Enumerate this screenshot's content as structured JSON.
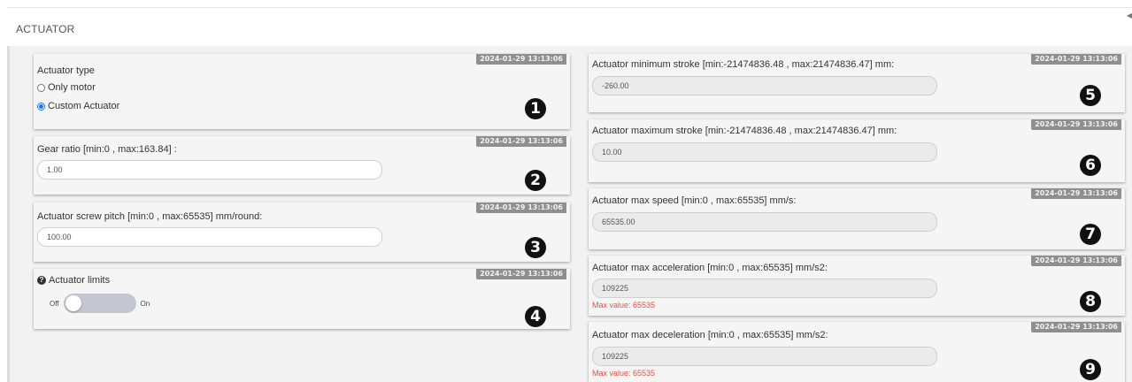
{
  "panel": {
    "title": "ACTUATOR",
    "collapse_icon": "caret-left-icon"
  },
  "left": {
    "actuator_type": {
      "timestamp": "2024-01-29 13:13:06",
      "label": "Actuator type",
      "options": [
        {
          "label": "Only motor",
          "selected": false
        },
        {
          "label": "Custom Actuator",
          "selected": true
        }
      ],
      "badge": "1"
    },
    "gear_ratio": {
      "timestamp": "2024-01-29 13:13:06",
      "label": "Gear ratio [min:0 , max:163.84] :",
      "value": "1.00",
      "badge": "2"
    },
    "screw_pitch": {
      "timestamp": "2024-01-29 13:13:06",
      "label": "Actuator screw pitch [min:0 , max:65535] mm/round:",
      "value": "100.00",
      "badge": "3"
    },
    "limits": {
      "timestamp": "2024-01-29 13:13:06",
      "label": "Actuator limits",
      "icon": "question-circle-icon",
      "off_label": "Off",
      "on_label": "On",
      "enabled": false,
      "badge": "4"
    }
  },
  "right": {
    "min_stroke": {
      "timestamp": "2024-01-29 13:13:06",
      "label": "Actuator minimum stroke [min:-21474836.48 , max:21474836.47] mm:",
      "value": "-260.00",
      "badge": "5"
    },
    "max_stroke": {
      "timestamp": "2024-01-29 13:13:06",
      "label": "Actuator maximum stroke [min:-21474836.48 , max:21474836.47] mm:",
      "value": "10.00",
      "badge": "6"
    },
    "max_speed": {
      "timestamp": "2024-01-29 13:13:06",
      "label": "Actuator max speed [min:0 , max:65535] mm/s:",
      "value": "65535.00",
      "badge": "7"
    },
    "max_accel": {
      "timestamp": "2024-01-29 13:13:06",
      "label": "Actuator max acceleration [min:0 , max:65535] mm/s2:",
      "value": "109225",
      "error": "Max value: 65535",
      "badge": "8"
    },
    "max_decel": {
      "timestamp": "2024-01-29 13:13:06",
      "label": "Actuator max deceleration [min:0 , max:65535] mm/s2:",
      "value": "109225",
      "error": "Max value: 65535",
      "badge": "9"
    }
  },
  "colors": {
    "accent": "#1a73e8",
    "error": "#e0524a",
    "timestamp_bg": "#8f8f8f"
  }
}
